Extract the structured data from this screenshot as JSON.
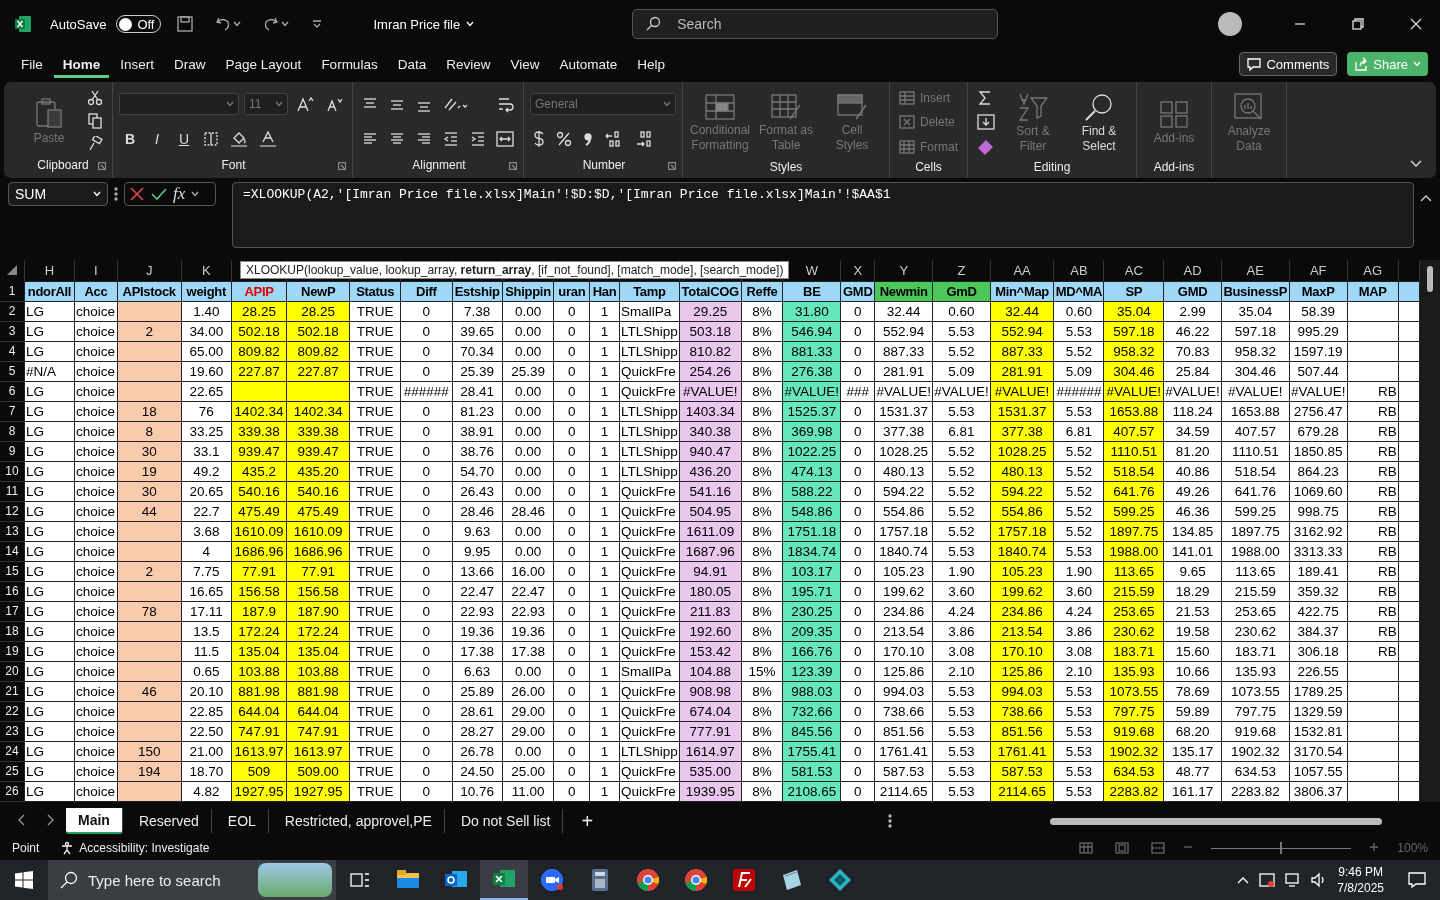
{
  "title_bar": {
    "autosave": {
      "label": "AutoSave",
      "on": false,
      "state_text": "Off"
    },
    "file_name": "Imran Price file",
    "search": {
      "placeholder": "Search"
    }
  },
  "menu": {
    "tabs": [
      {
        "label": "File",
        "selected": false
      },
      {
        "label": "Home",
        "selected": true
      },
      {
        "label": "Insert",
        "selected": false
      },
      {
        "label": "Draw",
        "selected": false
      },
      {
        "label": "Page Layout",
        "selected": false
      },
      {
        "label": "Formulas",
        "selected": false
      },
      {
        "label": "Data",
        "selected": false
      },
      {
        "label": "Review",
        "selected": false
      },
      {
        "label": "View",
        "selected": false
      },
      {
        "label": "Automate",
        "selected": false
      },
      {
        "label": "Help",
        "selected": false
      }
    ],
    "comments": "Comments",
    "share": "Share"
  },
  "ribbon": [
    {
      "label": "Clipboard",
      "launcher": true,
      "columns": [
        [
          [
            {
              "kind": "paste",
              "label": "Paste",
              "disabled": true
            }
          ]
        ],
        [
          [
            {
              "kind": "cut",
              "disabled": false
            }
          ],
          [
            {
              "kind": "copy",
              "disabled": false
            }
          ],
          [
            {
              "kind": "painter",
              "disabled": false
            }
          ]
        ]
      ]
    },
    {
      "label": "Font",
      "launcher": true,
      "columns": [
        [
          [
            {
              "kind": "font-field",
              "disabled": true
            },
            {
              "kind": "size-field",
              "value": "11",
              "disabled": true
            },
            {
              "kind": "grow",
              "disabled": false
            },
            {
              "kind": "shrink",
              "disabled": false
            }
          ],
          [
            {
              "kind": "bold",
              "label": "B",
              "disabled": false
            },
            {
              "kind": "italic",
              "label": "I",
              "disabled": false
            },
            {
              "kind": "underline",
              "label": "U",
              "disabled": false
            },
            {
              "kind": "borders",
              "disabled": false
            },
            {
              "kind": "fill",
              "disabled": false
            },
            {
              "kind": "font-color",
              "disabled": false
            }
          ]
        ]
      ]
    },
    {
      "label": "Alignment",
      "launcher": true,
      "columns": [
        [
          [
            {
              "kind": "align-top",
              "disabled": false
            },
            {
              "kind": "align-middle",
              "disabled": false
            },
            {
              "kind": "align-bottom",
              "disabled": false
            },
            {
              "kind": "orientation",
              "disabled": false
            }
          ],
          [
            {
              "kind": "align-left",
              "disabled": false
            },
            {
              "kind": "align-center",
              "disabled": false
            },
            {
              "kind": "align-right",
              "disabled": false
            },
            {
              "kind": "indent-dec",
              "disabled": false
            },
            {
              "kind": "indent-inc",
              "disabled": false
            }
          ]
        ],
        [
          [
            {
              "kind": "wrap",
              "disabled": false
            }
          ],
          [
            {
              "kind": "merge",
              "disabled": false
            }
          ]
        ]
      ]
    },
    {
      "label": "Number",
      "launcher": true,
      "columns": [
        [
          [
            {
              "kind": "format-field",
              "value": "General",
              "disabled": true
            }
          ],
          [
            {
              "kind": "currency",
              "disabled": false
            },
            {
              "kind": "percent",
              "disabled": false
            },
            {
              "kind": "comma",
              "disabled": false
            },
            {
              "kind": "dec-inc",
              "disabled": false
            },
            {
              "kind": "dec-dec",
              "disabled": false
            }
          ]
        ]
      ]
    },
    {
      "label": "Styles",
      "launcher": false,
      "columns": [
        [
          [
            {
              "kind": "conditional",
              "label": "Conditional Formatting",
              "disabled": true
            }
          ]
        ],
        [
          [
            {
              "kind": "table",
              "label": "Format as Table",
              "disabled": true
            }
          ]
        ],
        [
          [
            {
              "kind": "cellstyles",
              "label": "Cell Styles",
              "disabled": true
            }
          ]
        ]
      ]
    },
    {
      "label": "Cells",
      "launcher": false,
      "columns": [
        [
          [
            {
              "kind": "insert",
              "label": "Insert",
              "disabled": true
            }
          ],
          [
            {
              "kind": "delete",
              "label": "Delete",
              "disabled": true
            }
          ],
          [
            {
              "kind": "format",
              "label": "Format",
              "disabled": true
            }
          ]
        ]
      ]
    },
    {
      "label": "Editing",
      "launcher": false,
      "columns": [
        [
          [
            {
              "kind": "sum",
              "disabled": false
            }
          ],
          [
            {
              "kind": "fill-down",
              "disabled": false
            }
          ],
          [
            {
              "kind": "eraser",
              "disabled": false
            }
          ]
        ],
        [
          [
            {
              "kind": "sort",
              "label": "Sort & Filter",
              "disabled": true
            }
          ]
        ],
        [
          [
            {
              "kind": "find",
              "label": "Find & Select",
              "disabled": false
            }
          ]
        ]
      ]
    },
    {
      "label": "Add-ins",
      "launcher": false,
      "columns": [
        [
          [
            {
              "kind": "addins",
              "label": "Add-ins",
              "disabled": true
            }
          ]
        ]
      ]
    },
    {
      "launcher": false,
      "columns": [
        [
          [
            {
              "kind": "analyze",
              "label": "Analyze Data",
              "disabled": true
            }
          ]
        ]
      ]
    }
  ],
  "formula_bar": {
    "name_box": "SUM",
    "insert_function": "fx",
    "formula": "=XLOOKUP(A2,'[Imran Price file.xlsx]Main'!$D:$D,'[Imran Price file.xlsx]Main'!$AA$1"
  },
  "tooltip": "XLOOKUP(lookup_value, lookup_array, **return_array**, [if_not_found], [match_mode], [search_mode])",
  "sheet": {
    "columns": [
      {
        "letter": "H",
        "header": "ndorAll",
        "kind": "text"
      },
      {
        "letter": "I",
        "header": "Acc",
        "kind": "text"
      },
      {
        "letter": "J",
        "header": "APIstock",
        "kind": "input"
      },
      {
        "letter": "K",
        "header": "weight",
        "kind": "number"
      },
      {
        "header": "APIP",
        "kind": "key-price"
      },
      {
        "header": "NewP",
        "kind": "price"
      },
      {
        "header": "Status",
        "kind": "number"
      },
      {
        "header": "Diff",
        "kind": "number"
      },
      {
        "header": "Estship",
        "kind": "number"
      },
      {
        "header": "Shippin",
        "kind": "number"
      },
      {
        "header": "uran",
        "kind": "number"
      },
      {
        "header": "Han",
        "kind": "number"
      },
      {
        "header": "Tamp",
        "kind": "text"
      },
      {
        "header": "TotalCOG",
        "kind": "cost"
      },
      {
        "header": "Reffe",
        "kind": "number"
      },
      {
        "letter": "W",
        "header": "BE",
        "kind": "break-even"
      },
      {
        "letter": "X",
        "header": "GMD",
        "kind": "number"
      },
      {
        "letter": "Y",
        "header": "Newmin",
        "kind": "green-header"
      },
      {
        "letter": "Z",
        "header": "GmD",
        "kind": "green-header"
      },
      {
        "letter": "AA",
        "header": "Min^Map",
        "kind": "price"
      },
      {
        "letter": "AB",
        "header": "MD^MA",
        "kind": "number"
      },
      {
        "letter": "AC",
        "header": "SP",
        "kind": "price"
      },
      {
        "letter": "AD",
        "header": "GMD",
        "kind": "number"
      },
      {
        "letter": "AE",
        "header": "BusinessP",
        "kind": "number"
      },
      {
        "letter": "AF",
        "header": "MaxP",
        "kind": "number"
      },
      {
        "letter": "AG",
        "header": "MAP",
        "kind": "note"
      }
    ],
    "header_row": "1",
    "rows": [
      {
        "number": "2",
        "cells": [
          "LG",
          "choice",
          null,
          "1.40",
          "28.25",
          "28.25",
          "TRUE",
          "0",
          "7.38",
          "0.00",
          "0",
          "1",
          "SmallPa",
          "29.25",
          "8%",
          "31.80",
          "0",
          "32.44",
          "0.60",
          "32.44",
          "0.60",
          "35.04",
          "2.99",
          "35.04",
          "58.39",
          null
        ]
      },
      {
        "number": "3",
        "cells": [
          "LG",
          "choice",
          "2",
          "34.00",
          "502.18",
          "502.18",
          "TRUE",
          "0",
          "39.65",
          "0.00",
          "0",
          "1",
          "LTLShipp",
          "503.18",
          "8%",
          "546.94",
          "0",
          "552.94",
          "5.53",
          "552.94",
          "5.53",
          "597.18",
          "46.22",
          "597.18",
          "995.29",
          null
        ]
      },
      {
        "number": "4",
        "cells": [
          "LG",
          "choice",
          null,
          "65.00",
          "809.82",
          "809.82",
          "TRUE",
          "0",
          "70.34",
          "0.00",
          "0",
          "1",
          "LTLShipp",
          "810.82",
          "8%",
          "881.33",
          "0",
          "887.33",
          "5.52",
          "887.33",
          "5.52",
          "958.32",
          "70.83",
          "958.32",
          "1597.19",
          null
        ]
      },
      {
        "number": "5",
        "cells": [
          "#N/A",
          "choice",
          null,
          "19.60",
          "227.87",
          "227.87",
          "TRUE",
          "0",
          "25.39",
          "25.39",
          "0",
          "1",
          "QuickFre",
          "254.26",
          "8%",
          "276.38",
          "0",
          "281.91",
          "5.09",
          "281.91",
          "5.09",
          "304.46",
          "25.84",
          "304.46",
          "507.44",
          null
        ]
      },
      {
        "number": "6",
        "cells": [
          "LG",
          "choice",
          null,
          "22.65",
          null,
          null,
          "TRUE",
          "######",
          "28.41",
          "0.00",
          "0",
          "1",
          "QuickFre",
          "#VALUE!",
          "8%",
          "#VALUE!",
          "###",
          "#VALUE!",
          "#VALUE!",
          "#VALUE!",
          "######",
          "#VALUE!",
          "#VALUE!",
          "#VALUE!",
          "#VALUE!",
          "RB"
        ]
      },
      {
        "number": "7",
        "cells": [
          "LG",
          "choice",
          "18",
          "76",
          "1402.34",
          "1402.34",
          "TRUE",
          "0",
          "81.23",
          "0.00",
          "0",
          "1",
          "LTLShipp",
          "1403.34",
          "8%",
          "1525.37",
          "0",
          "1531.37",
          "5.53",
          "1531.37",
          "5.53",
          "1653.88",
          "118.24",
          "1653.88",
          "2756.47",
          "RB"
        ]
      },
      {
        "number": "8",
        "cells": [
          "LG",
          "choice",
          "8",
          "33.25",
          "339.38",
          "339.38",
          "TRUE",
          "0",
          "38.91",
          "0.00",
          "0",
          "1",
          "LTLShipp",
          "340.38",
          "8%",
          "369.98",
          "0",
          "377.38",
          "6.81",
          "377.38",
          "6.81",
          "407.57",
          "34.59",
          "407.57",
          "679.28",
          "RB"
        ]
      },
      {
        "number": "9",
        "cells": [
          "LG",
          "choice",
          "30",
          "33.1",
          "939.47",
          "939.47",
          "TRUE",
          "0",
          "38.76",
          "0.00",
          "0",
          "1",
          "LTLShipp",
          "940.47",
          "8%",
          "1022.25",
          "0",
          "1028.25",
          "5.52",
          "1028.25",
          "5.52",
          "1110.51",
          "81.20",
          "1110.51",
          "1850.85",
          "RB"
        ]
      },
      {
        "number": "10",
        "cells": [
          "LG",
          "choice",
          "19",
          "49.2",
          "435.2",
          "435.20",
          "TRUE",
          "0",
          "54.70",
          "0.00",
          "0",
          "1",
          "LTLShipp",
          "436.20",
          "8%",
          "474.13",
          "0",
          "480.13",
          "5.52",
          "480.13",
          "5.52",
          "518.54",
          "40.86",
          "518.54",
          "864.23",
          "RB"
        ]
      },
      {
        "number": "11",
        "cells": [
          "LG",
          "choice",
          "30",
          "20.65",
          "540.16",
          "540.16",
          "TRUE",
          "0",
          "26.43",
          "0.00",
          "0",
          "1",
          "QuickFre",
          "541.16",
          "8%",
          "588.22",
          "0",
          "594.22",
          "5.52",
          "594.22",
          "5.52",
          "641.76",
          "49.26",
          "641.76",
          "1069.60",
          "RB"
        ]
      },
      {
        "number": "12",
        "cells": [
          "LG",
          "choice",
          "44",
          "22.7",
          "475.49",
          "475.49",
          "TRUE",
          "0",
          "28.46",
          "28.46",
          "0",
          "1",
          "QuickFre",
          "504.95",
          "8%",
          "548.86",
          "0",
          "554.86",
          "5.52",
          "554.86",
          "5.52",
          "599.25",
          "46.36",
          "599.25",
          "998.75",
          "RB"
        ]
      },
      {
        "number": "13",
        "cells": [
          "LG",
          "choice",
          null,
          "3.68",
          "1610.09",
          "1610.09",
          "TRUE",
          "0",
          "9.63",
          "0.00",
          "0",
          "1",
          "QuickFre",
          "1611.09",
          "8%",
          "1751.18",
          "0",
          "1757.18",
          "5.52",
          "1757.18",
          "5.52",
          "1897.75",
          "134.85",
          "1897.75",
          "3162.92",
          "RB"
        ]
      },
      {
        "number": "14",
        "cells": [
          "LG",
          "choice",
          null,
          "4",
          "1686.96",
          "1686.96",
          "TRUE",
          "0",
          "9.95",
          "0.00",
          "0",
          "1",
          "QuickFre",
          "1687.96",
          "8%",
          "1834.74",
          "0",
          "1840.74",
          "5.53",
          "1840.74",
          "5.53",
          "1988.00",
          "141.01",
          "1988.00",
          "3313.33",
          "RB"
        ]
      },
      {
        "number": "15",
        "cells": [
          "LG",
          "choice",
          "2",
          "7.75",
          "77.91",
          "77.91",
          "TRUE",
          "0",
          "13.66",
          "16.00",
          "0",
          "1",
          "QuickFre",
          "94.91",
          "8%",
          "103.17",
          "0",
          "105.23",
          "1.90",
          "105.23",
          "1.90",
          "113.65",
          "9.65",
          "113.65",
          "189.41",
          "RB"
        ]
      },
      {
        "number": "16",
        "cells": [
          "LG",
          "choice",
          null,
          "16.65",
          "156.58",
          "156.58",
          "TRUE",
          "0",
          "22.47",
          "22.47",
          "0",
          "1",
          "QuickFre",
          "180.05",
          "8%",
          "195.71",
          "0",
          "199.62",
          "3.60",
          "199.62",
          "3.60",
          "215.59",
          "18.29",
          "215.59",
          "359.32",
          "RB"
        ]
      },
      {
        "number": "17",
        "cells": [
          "LG",
          "choice",
          "78",
          "17.11",
          "187.9",
          "187.90",
          "TRUE",
          "0",
          "22.93",
          "22.93",
          "0",
          "1",
          "QuickFre",
          "211.83",
          "8%",
          "230.25",
          "0",
          "234.86",
          "4.24",
          "234.86",
          "4.24",
          "253.65",
          "21.53",
          "253.65",
          "422.75",
          "RB"
        ]
      },
      {
        "number": "18",
        "cells": [
          "LG",
          "choice",
          null,
          "13.5",
          "172.24",
          "172.24",
          "TRUE",
          "0",
          "19.36",
          "19.36",
          "0",
          "1",
          "QuickFre",
          "192.60",
          "8%",
          "209.35",
          "0",
          "213.54",
          "3.86",
          "213.54",
          "3.86",
          "230.62",
          "19.58",
          "230.62",
          "384.37",
          "RB"
        ]
      },
      {
        "number": "19",
        "cells": [
          "LG",
          "choice",
          null,
          "11.5",
          "135.04",
          "135.04",
          "TRUE",
          "0",
          "17.38",
          "17.38",
          "0",
          "1",
          "QuickFre",
          "153.42",
          "8%",
          "166.76",
          "0",
          "170.10",
          "3.08",
          "170.10",
          "3.08",
          "183.71",
          "15.60",
          "183.71",
          "306.18",
          "RB"
        ]
      },
      {
        "number": "20",
        "cells": [
          "LG",
          "choice",
          null,
          "0.65",
          "103.88",
          "103.88",
          "TRUE",
          "0",
          "6.63",
          "0.00",
          "0",
          "1",
          "SmallPa",
          "104.88",
          "15%",
          "123.39",
          "0",
          "125.86",
          "2.10",
          "125.86",
          "2.10",
          "135.93",
          "10.66",
          "135.93",
          "226.55",
          null
        ]
      },
      {
        "number": "21",
        "cells": [
          "LG",
          "choice",
          "46",
          "20.10",
          "881.98",
          "881.98",
          "TRUE",
          "0",
          "25.89",
          "26.00",
          "0",
          "1",
          "QuickFre",
          "908.98",
          "8%",
          "988.03",
          "0",
          "994.03",
          "5.53",
          "994.03",
          "5.53",
          "1073.55",
          "78.69",
          "1073.55",
          "1789.25",
          null
        ]
      },
      {
        "number": "22",
        "cells": [
          "LG",
          "choice",
          null,
          "22.85",
          "644.04",
          "644.04",
          "TRUE",
          "0",
          "28.61",
          "29.00",
          "0",
          "1",
          "QuickFre",
          "674.04",
          "8%",
          "732.66",
          "0",
          "738.66",
          "5.53",
          "738.66",
          "5.53",
          "797.75",
          "59.89",
          "797.75",
          "1329.59",
          null
        ]
      },
      {
        "number": "23",
        "cells": [
          "LG",
          "choice",
          null,
          "22.50",
          "747.91",
          "747.91",
          "TRUE",
          "0",
          "28.27",
          "29.00",
          "0",
          "1",
          "QuickFre",
          "777.91",
          "8%",
          "845.56",
          "0",
          "851.56",
          "5.53",
          "851.56",
          "5.53",
          "919.68",
          "68.20",
          "919.68",
          "1532.81",
          null
        ]
      },
      {
        "number": "24",
        "cells": [
          "LG",
          "choice",
          "150",
          "21.00",
          "1613.97",
          "1613.97",
          "TRUE",
          "0",
          "26.78",
          "0.00",
          "0",
          "1",
          "LTLShipp",
          "1614.97",
          "8%",
          "1755.41",
          "0",
          "1761.41",
          "5.53",
          "1761.41",
          "5.53",
          "1902.32",
          "135.17",
          "1902.32",
          "3170.54",
          null
        ]
      },
      {
        "number": "25",
        "cells": [
          "LG",
          "choice",
          "194",
          "18.70",
          "509",
          "509.00",
          "TRUE",
          "0",
          "24.50",
          "25.00",
          "0",
          "1",
          "QuickFre",
          "535.00",
          "8%",
          "581.53",
          "0",
          "587.53",
          "5.53",
          "587.53",
          "5.53",
          "634.53",
          "48.77",
          "634.53",
          "1057.55",
          null
        ]
      },
      {
        "number": "26",
        "cells": [
          "LG",
          "choice",
          null,
          "4.82",
          "1927.95",
          "1927.95",
          "TRUE",
          "0",
          "10.76",
          "11.00",
          "0",
          "1",
          "QuickFre",
          "1939.95",
          "8%",
          "2108.65",
          "0",
          "2114.65",
          "5.53",
          "2114.65",
          "5.53",
          "2283.82",
          "161.17",
          "2283.82",
          "3806.37",
          null
        ]
      }
    ]
  },
  "sheet_tabs": {
    "tabs": [
      {
        "label": "Main",
        "selected": true
      },
      {
        "label": "Reserved",
        "selected": false
      },
      {
        "label": "EOL",
        "selected": false
      },
      {
        "label": "Restricted, approvel,PE",
        "selected": false
      },
      {
        "label": "Do not Sell list",
        "selected": false
      }
    ],
    "add": "+"
  },
  "status_bar": {
    "mode": "Point",
    "accessibility": "Accessibility: Investigate",
    "zoom": {
      "level": 0.5,
      "reading": "100%"
    }
  },
  "taskbar": {
    "search": {
      "placeholder": "Type here to search"
    },
    "apps": [
      {
        "kind": "folder",
        "selected": false
      },
      {
        "kind": "mail",
        "selected": false
      },
      {
        "kind": "sheet",
        "selected": true
      },
      {
        "kind": "video",
        "selected": false
      },
      {
        "kind": "calculator",
        "selected": false
      },
      {
        "kind": "browser",
        "selected": false
      },
      {
        "kind": "browser",
        "selected": false
      },
      {
        "kind": "ftp",
        "selected": false
      },
      {
        "kind": "notes",
        "selected": false
      },
      {
        "kind": "cube",
        "selected": false
      }
    ],
    "time": "9:46 PM",
    "date": "7/8/2025"
  }
}
